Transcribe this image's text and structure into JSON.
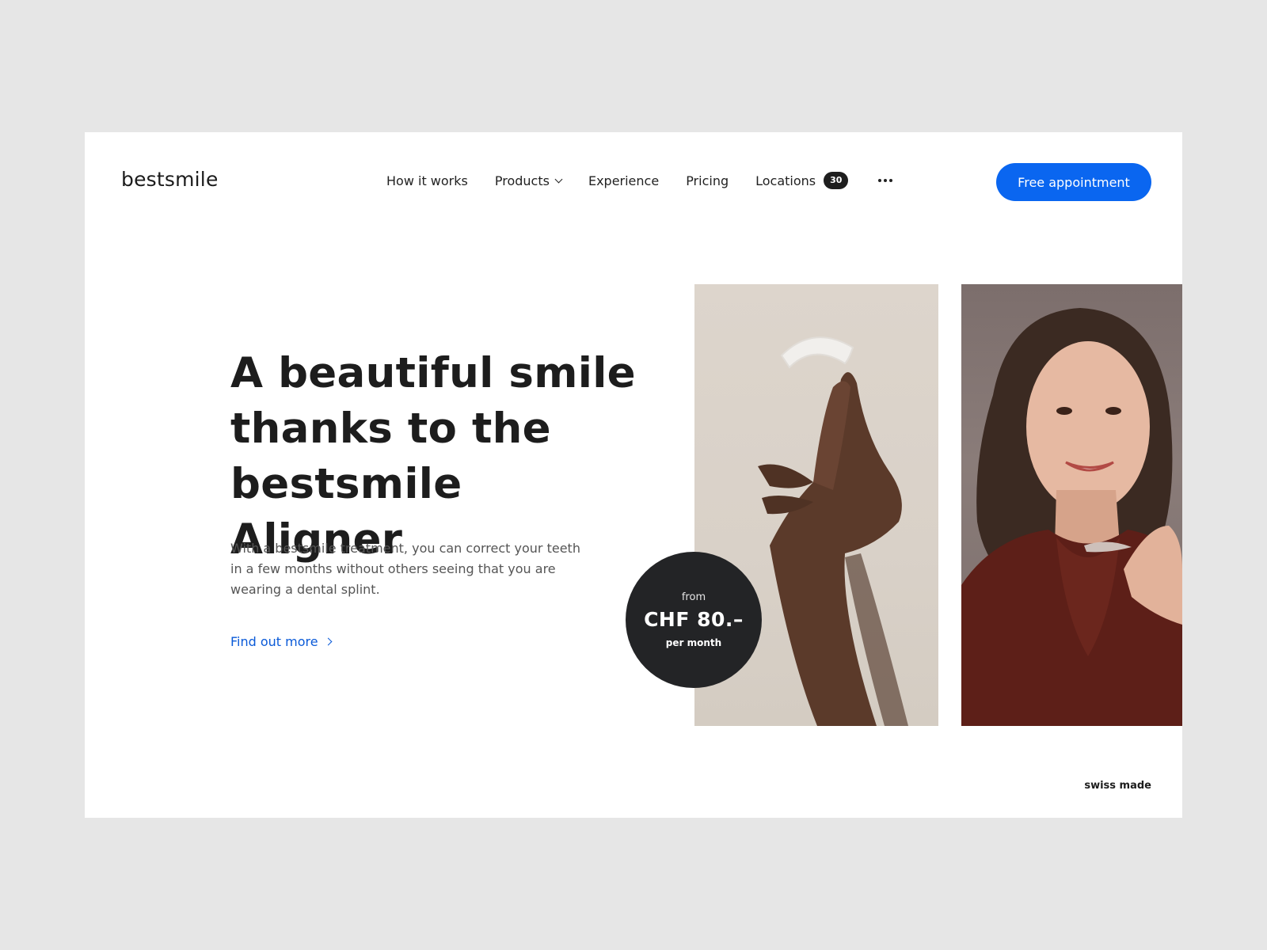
{
  "header": {
    "logo": "bestsmile",
    "nav": [
      {
        "label": "How it works"
      },
      {
        "label": "Products"
      },
      {
        "label": "Experience"
      },
      {
        "label": "Pricing"
      },
      {
        "label": "Locations",
        "badge": "30"
      }
    ],
    "more_icon": "ellipsis-icon",
    "cta_label": "Free appointment"
  },
  "hero": {
    "headline": "A beautiful smile thanks to the bestsmile Aligner",
    "lead": "With a bestsmile treatment, you can correct your teeth in a few months without others seeing that you are wearing a dental splint.",
    "link_label": "Find out more",
    "link_icon": "chevron-right-icon"
  },
  "price": {
    "from": "from",
    "amount": "CHF 80.–",
    "per": "per month"
  },
  "footer": {
    "tagline": "swiss made"
  },
  "colors": {
    "accent": "#0a66f0",
    "dark": "#232426",
    "background": "#e6e6e6"
  }
}
